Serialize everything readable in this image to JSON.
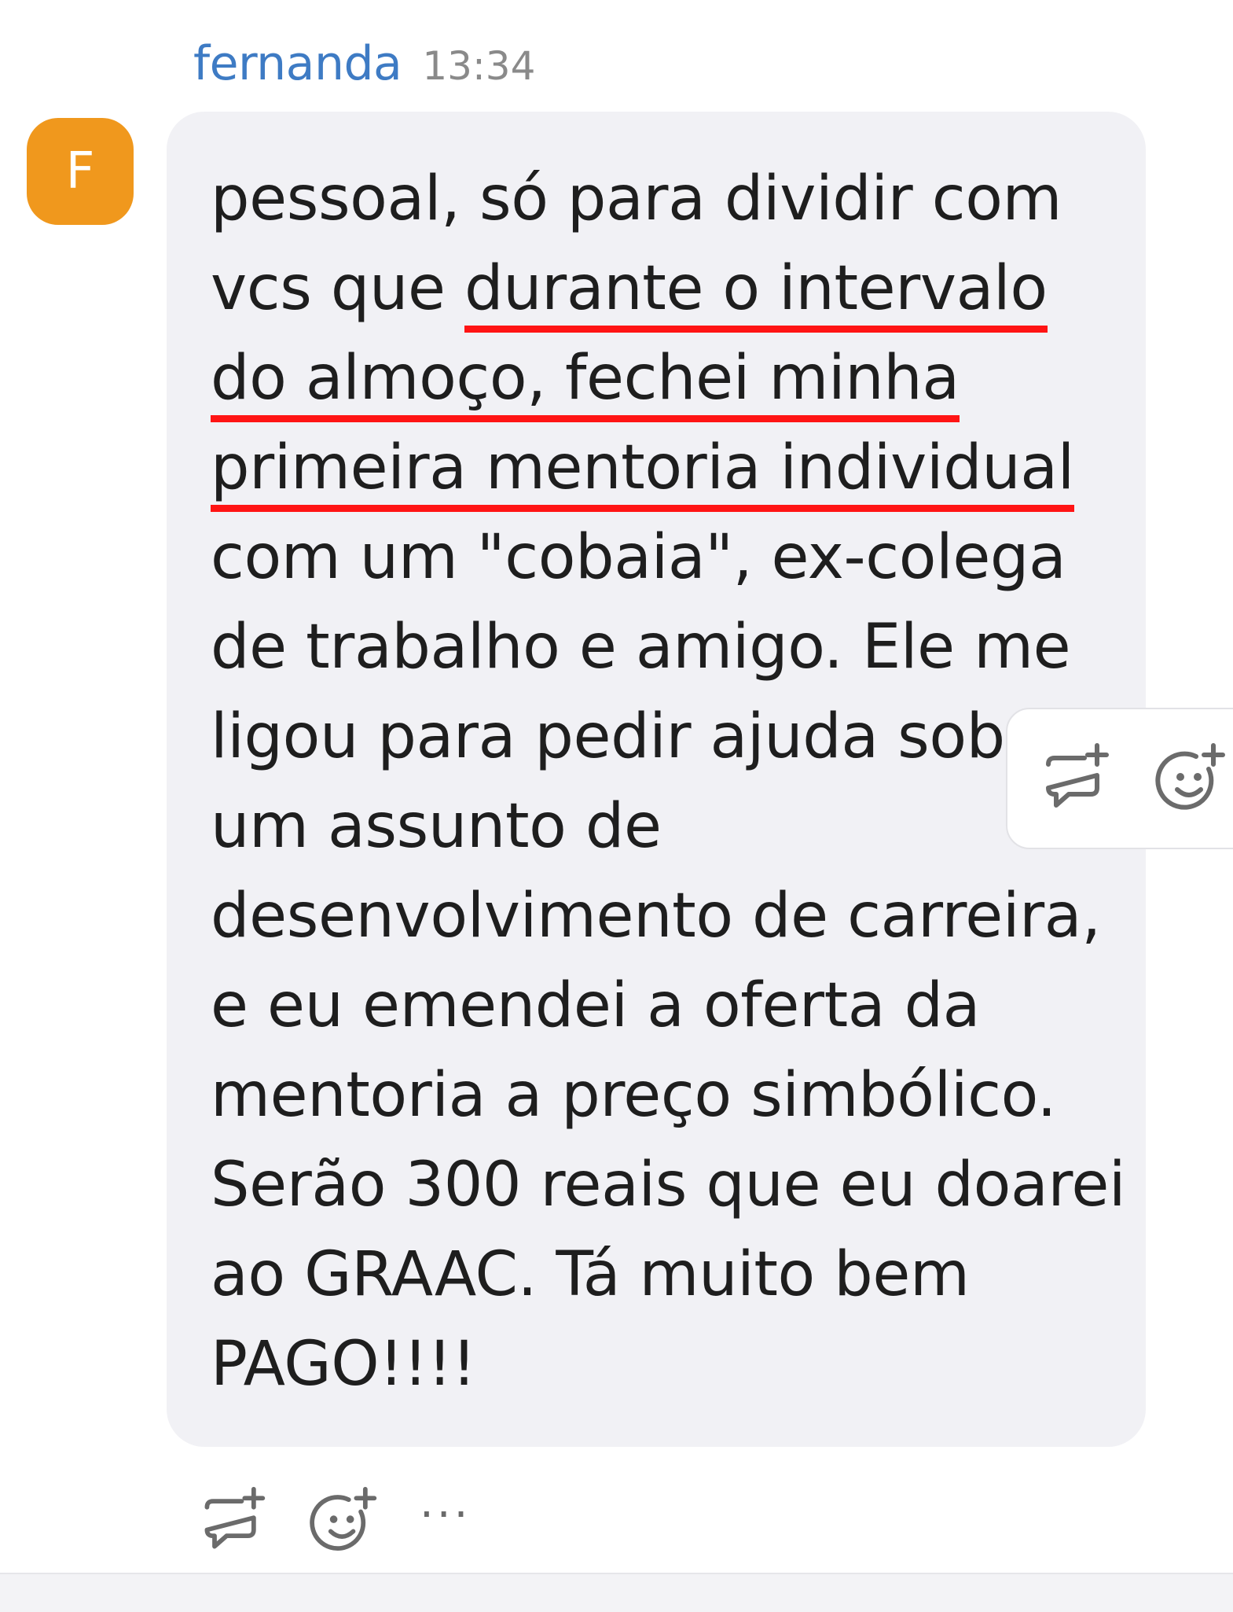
{
  "message": {
    "author": "fernanda",
    "time": "13:34",
    "avatar_letter": "F",
    "lines": [
      {
        "pre": "pessoal, só para dividir com",
        "hl": "",
        "post": ""
      },
      {
        "pre": "vcs que ",
        "hl": "durante o intervalo",
        "post": ""
      },
      {
        "pre": "",
        "hl": "do almoço, fechei minha",
        "post": ""
      },
      {
        "pre": "",
        "hl": "primeira mentoria individual",
        "post": ""
      },
      {
        "pre": "com um \"cobaia\", ex-colega",
        "hl": "",
        "post": ""
      },
      {
        "pre": "de trabalho e amigo. Ele me",
        "hl": "",
        "post": ""
      },
      {
        "pre": "ligou para pedir ajuda sobr",
        "hl": "",
        "post": ""
      },
      {
        "pre": "um assunto de",
        "hl": "",
        "post": ""
      },
      {
        "pre": "desenvolvimento de carreira,",
        "hl": "",
        "post": ""
      },
      {
        "pre": "e eu emendei a oferta da",
        "hl": "",
        "post": ""
      },
      {
        "pre": "mentoria a preço simbólico.",
        "hl": "",
        "post": ""
      },
      {
        "pre": "Serão 300 reais que eu doarei",
        "hl": "",
        "post": ""
      },
      {
        "pre": "ao GRAAC. Tá muito bem",
        "hl": "",
        "post": ""
      },
      {
        "pre": "PAGO!!!!",
        "hl": "",
        "post": ""
      }
    ],
    "underline_color": "#ff1414"
  },
  "hover_toolbar": {
    "icons": [
      "reply-in-thread-icon",
      "add-reaction-icon"
    ]
  },
  "actions": {
    "icons": [
      "reply-in-thread-icon",
      "add-reaction-icon",
      "more-options-icon"
    ],
    "more_label": "···"
  },
  "colors": {
    "username": "#3e7bc4",
    "avatar": "#f0981d",
    "bubble": "#f1f1f5"
  }
}
